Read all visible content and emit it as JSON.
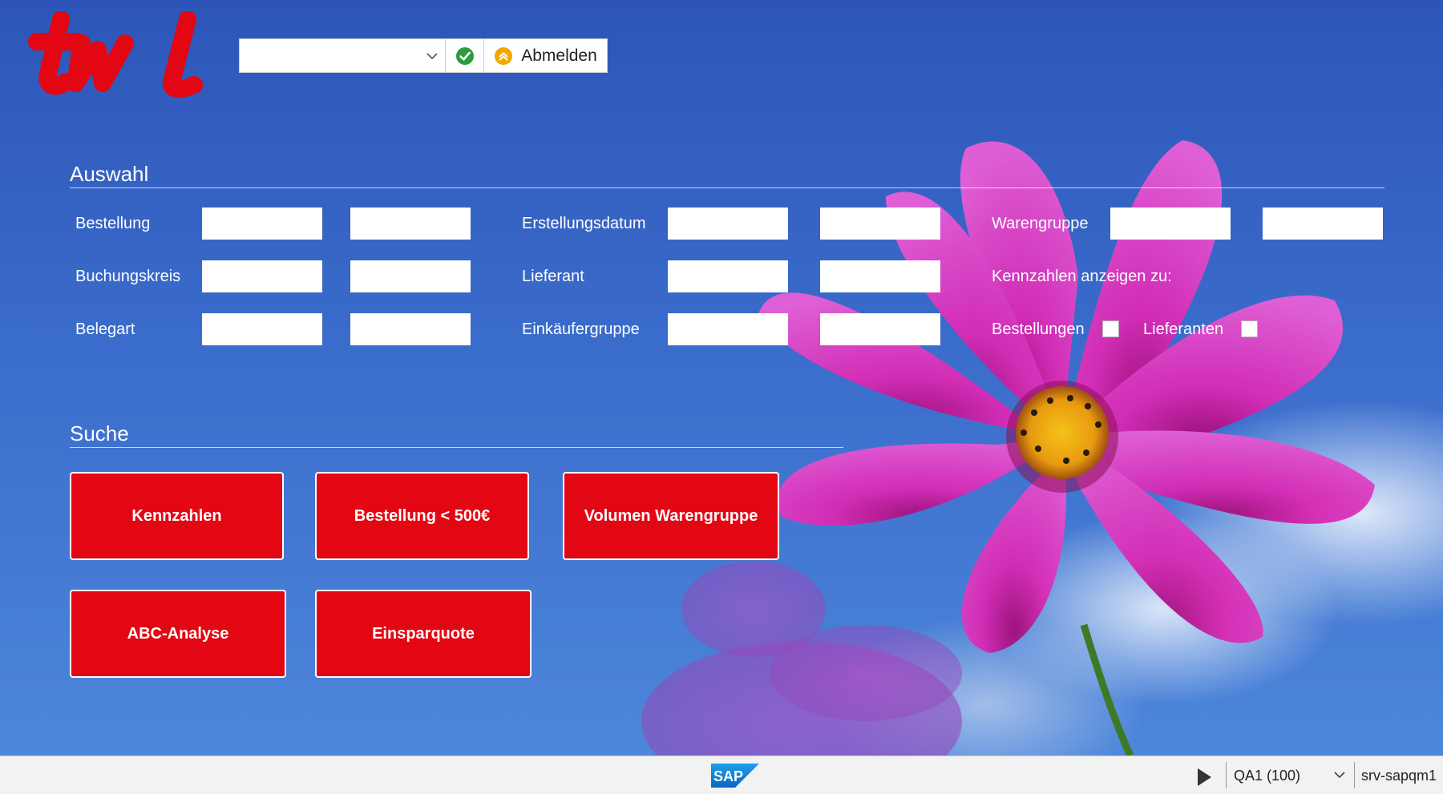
{
  "toolbar": {
    "dropdown_value": "",
    "logout_label": "Abmelden"
  },
  "auswahl": {
    "title": "Auswahl",
    "fields": [
      {
        "label": "Bestellung"
      },
      {
        "label": "Buchungskreis"
      },
      {
        "label": "Belegart"
      },
      {
        "label": "Erstellungsdatum"
      },
      {
        "label": "Lieferant"
      },
      {
        "label": "Einkäufergruppe"
      },
      {
        "label": "Warengruppe"
      }
    ],
    "kennzahlen_label": "Kennzahlen anzeigen zu:",
    "checkboxes": [
      {
        "label": "Bestellungen",
        "checked": false
      },
      {
        "label": "Lieferanten",
        "checked": false
      }
    ]
  },
  "suche": {
    "title": "Suche",
    "buttons": [
      "Kennzahlen",
      "Bestellung < 500€",
      "Volumen Warengruppe",
      "ABC-Analyse",
      "Einsparquote"
    ]
  },
  "footer": {
    "system": "QA1 (100)",
    "server": "srv-sapqm1"
  },
  "colors": {
    "brand_red": "#e30613",
    "background_blue": "#2f5fc0"
  },
  "icons": [
    "twl-logo",
    "chevron-down-icon",
    "check-icon",
    "logout-icon",
    "sap-logo",
    "play-icon"
  ]
}
